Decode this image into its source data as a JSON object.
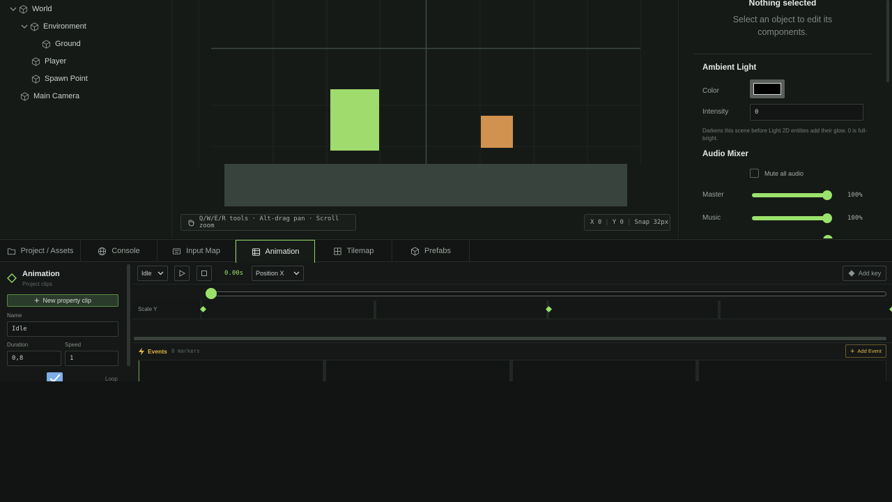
{
  "hierarchy": {
    "items": [
      {
        "label": "World",
        "expanded": true
      },
      {
        "label": "Environment",
        "expanded": true
      },
      {
        "label": "Ground"
      },
      {
        "label": "Player"
      },
      {
        "label": "Spawn Point"
      },
      {
        "label": "Main Camera"
      }
    ]
  },
  "viewport": {
    "hint": "Q/W/E/R tools · Alt-drag pan · Scroll zoom",
    "coord_x": "X 0",
    "coord_y": "Y 0",
    "snap": "Snap 32px"
  },
  "inspector": {
    "empty_title": "Nothing selected",
    "empty_hint": "Select an object to edit its components.",
    "ambient": {
      "title": "Ambient Light",
      "color_label": "Color",
      "color_value": "#000000",
      "intensity_label": "Intensity",
      "intensity_value": "0",
      "note": "Darkens this scene before Light 2D entities add their glow. 0 is full-bright."
    },
    "audio": {
      "title": "Audio Mixer",
      "mute_label": "Mute all audio",
      "master_label": "Master",
      "master_pct": "100%",
      "master_level": 1.0,
      "music_label": "Music",
      "music_pct": "100%",
      "music_level": 1.0
    }
  },
  "tabs": [
    {
      "label": "Project / Assets",
      "icon": "folder-icon"
    },
    {
      "label": "Console",
      "icon": "globe-icon"
    },
    {
      "label": "Input Map",
      "icon": "keyboard-icon"
    },
    {
      "label": "Animation",
      "icon": "film-icon",
      "active": true
    },
    {
      "label": "Tilemap",
      "icon": "grid-icon"
    },
    {
      "label": "Prefabs",
      "icon": "cube-icon"
    }
  ],
  "animation": {
    "title": "Animation",
    "subtitle": "Project clips",
    "new_clip_label": "New property clip",
    "name_label": "Name",
    "name_value": "Idle",
    "duration_label": "Duration",
    "duration_value": "0,8",
    "speed_label": "Speed",
    "speed_value": "1",
    "loop_label": "Loop",
    "clip_select": "Idle",
    "time": "0.00s",
    "property_select": "Position X",
    "add_key_label": "Add key",
    "track_label": "Scale Y",
    "events_label": "Events",
    "events_count": "0 markers",
    "add_event_label": "Add Event"
  },
  "colors": {
    "accent": "#9be26c",
    "player": "#9fdb6d",
    "spawn": "#d1914f",
    "ground": "#38433d",
    "events": "#e0b64d"
  }
}
